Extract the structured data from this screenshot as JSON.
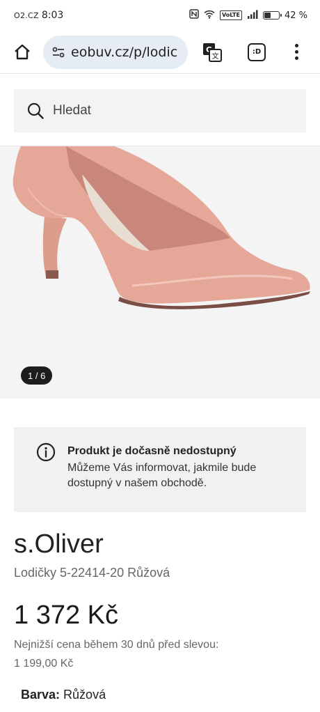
{
  "status_bar": {
    "carrier": "O2.CZ",
    "time": "8:03",
    "network": "VoLTE",
    "battery": "42 %",
    "battery_level": 0.42
  },
  "browser": {
    "url": "eobuv.cz/p/lodic",
    "tab_count": ":D"
  },
  "search": {
    "placeholder": "Hledat"
  },
  "gallery": {
    "counter": "1 / 6"
  },
  "notice": {
    "title": "Produkt je dočasně nedostupný",
    "text": "Můžeme Vás informovat, jakmile bude dostupný v našem obchodě."
  },
  "product": {
    "brand": "s.Oliver",
    "name": "Lodičky 5-22414-20 Růžová",
    "price": "1 372 Kč",
    "lowest_price_label": "Nejnižší cena během 30 dnů před slevou:",
    "lowest_price_value": "1 199,00 Kč",
    "color_label": "Barva:",
    "color_value": "Růžová"
  },
  "colors": {
    "shoe_outer": "#e5a898",
    "shoe_inner": "#d18f80",
    "insole": "#e8ddd2",
    "url_pill": "#e6ecf4"
  }
}
